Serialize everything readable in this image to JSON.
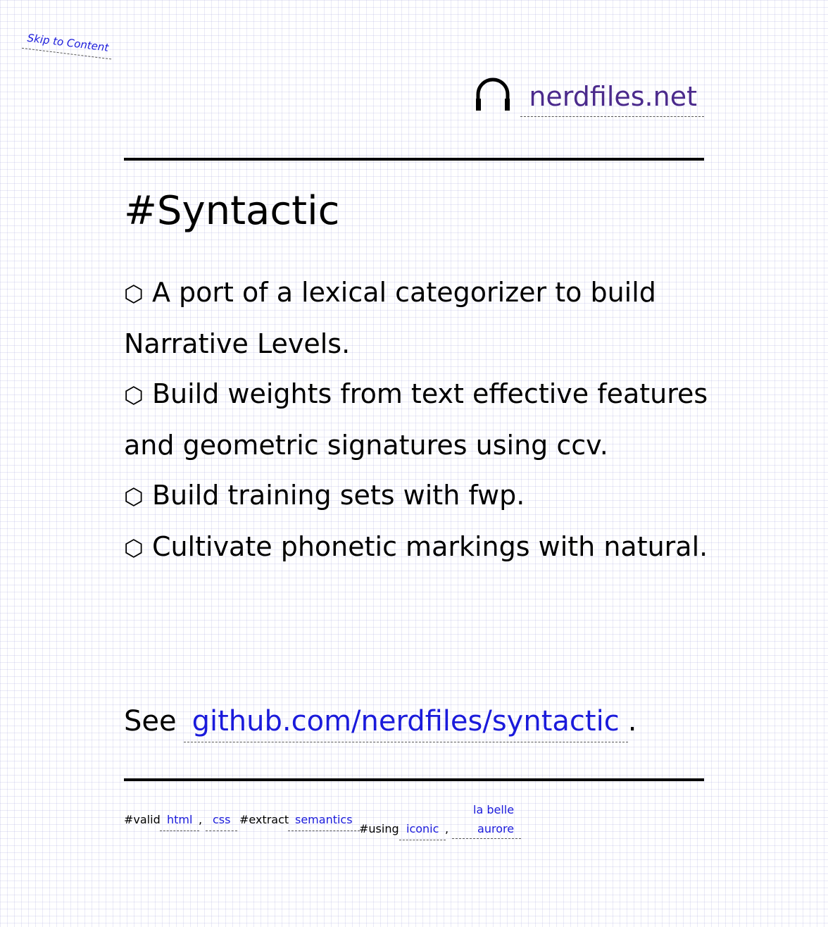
{
  "skip_link": "Skip to Content",
  "header": {
    "site_name": "nerdfiles.net",
    "icon": "headphones-icon"
  },
  "page": {
    "title": "#Syntactic",
    "bullet": "⬡",
    "items": [
      "A port of a lexical categorizer to build Narrative Levels.",
      "Build weights from text effective features and geometric signatures using ccv.",
      "Build training sets with fwp.",
      "Cultivate phonetic markings with natural."
    ],
    "see_prefix": "See",
    "see_link": "github.com/nerdfiles/syntactic",
    "see_suffix": "."
  },
  "footer": {
    "valid_label": "#valid",
    "html_link": "html",
    "comma": ",",
    "css_link": "css",
    "extract_label": "#extract",
    "semantics_link": "semantics",
    "using_label": "#using",
    "iconic_link": "iconic",
    "font_link_line1": "la belle",
    "font_link_line2": "aurore"
  },
  "colors": {
    "link": "#1a1adb",
    "brand": "#4b2a8c",
    "grid": "#d9d9f0"
  }
}
